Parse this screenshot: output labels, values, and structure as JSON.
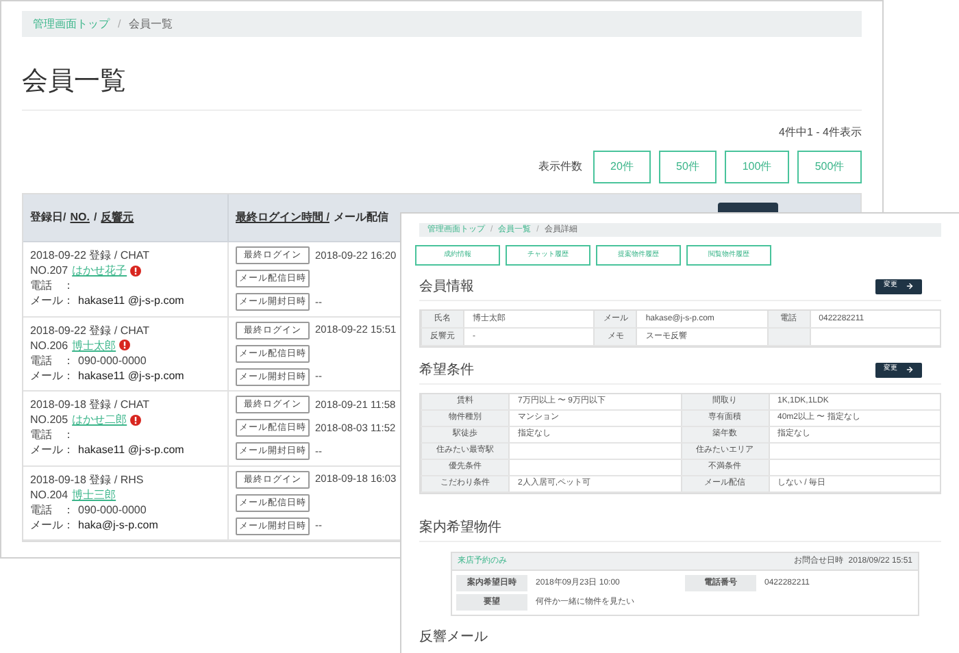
{
  "main": {
    "breadcrumb": [
      {
        "label": "管理画面トップ",
        "link": true
      },
      {
        "label": "会員一覧",
        "link": false
      }
    ],
    "separator": "/",
    "title": "会員一覧",
    "count": "4件中1 - 4件表示",
    "page_size": {
      "label": "表示件数",
      "options": [
        "20件",
        "50件",
        "100件",
        "500件"
      ]
    },
    "table": {
      "header": [
        {
          "segments": [
            {
              "text": "登録日/",
              "link": false
            },
            {
              "text": "NO.",
              "link": true
            },
            {
              "text": "/",
              "link": false
            },
            {
              "text": "反響元",
              "link": true
            }
          ]
        },
        {
          "segments": [
            {
              "text": "最終ログイン時間 /",
              "link": true
            },
            {
              "text": "メール配信",
              "link": false
            }
          ]
        }
      ],
      "rows": [
        {
          "registered": "2018-09-22 登録 / CHAT",
          "no": "NO.207",
          "name": "はかせ花子",
          "alert": true,
          "phone_label": "電話　：",
          "mail_label": "メール：",
          "mail": "hakase11 @j-s-p.com",
          "logs": [
            {
              "label": "最終ログイン",
              "value": "2018-09-22 16:20"
            },
            {
              "label": "メール配信日時"
            },
            {
              "label": "メール開封日時",
              "value": "--"
            }
          ]
        },
        {
          "registered": "2018-09-22 登録 / CHAT",
          "no": "NO.206",
          "name": "博士太郎",
          "alert": true,
          "phone_label": "電話　：",
          "phone": "090-000-0000",
          "mail_label": "メール：",
          "mail": "hakase11 @j-s-p.com",
          "logs": [
            {
              "label": "最終ログイン",
              "value": "2018-09-22 15:51"
            },
            {
              "label": "メール配信日時"
            },
            {
              "label": "メール開封日時",
              "value": "--"
            }
          ]
        },
        {
          "registered": "2018-09-18 登録 / CHAT",
          "no": "NO.205",
          "name": "はかせ二郎",
          "alert": true,
          "phone_label": "電話　：",
          "mail_label": "メール：",
          "mail": "hakase11 @j-s-p.com",
          "logs": [
            {
              "label": "最終ログイン",
              "value": "2018-09-21 11:58"
            },
            {
              "label": "メール配信日時",
              "value": "2018-08-03 11:52"
            },
            {
              "label": "メール開封日時",
              "value": "--"
            }
          ]
        },
        {
          "registered": "2018-09-18 登録 / RHS",
          "no": "NO.204",
          "name": "博士三郎",
          "alert": false,
          "phone_label": "電話　：",
          "phone": "090-000-0000",
          "mail_label": "メール：",
          "mail": "haka@j-s-p.com",
          "logs": [
            {
              "label": "最終ログイン",
              "value": "2018-09-18 16:03"
            },
            {
              "label": "メール配信日時"
            },
            {
              "label": "メール開封日時",
              "value": "--"
            }
          ]
        }
      ]
    }
  },
  "detail": {
    "breadcrumb": [
      {
        "label": "管理画面トップ",
        "link": true
      },
      {
        "label": "会員一覧",
        "link": true
      },
      {
        "label": "会員詳細",
        "link": false
      }
    ],
    "separator": "/",
    "tabs": [
      "成約情報",
      "チャット履歴",
      "提案物件履歴",
      "閲覧物件履歴"
    ],
    "sections": [
      {
        "kind": "fields",
        "title": "会員情報",
        "button": "変更",
        "rows": [
          [
            {
              "label": "氏名",
              "value": "博士太郎"
            },
            {
              "label": "メール",
              "value": "hakase@j-s-p.com"
            },
            {
              "label": "電話",
              "value": "0422282211"
            }
          ],
          [
            {
              "label": "反響元",
              "value": "-"
            },
            {
              "label": "メモ",
              "value": "スーモ反響"
            },
            {}
          ]
        ]
      },
      {
        "kind": "fields",
        "title": "希望条件",
        "button": "変更",
        "rows": [
          [
            {
              "label": "賃料",
              "value": "7万円以上 〜 9万円以下"
            },
            {
              "label": "間取り",
              "value": "1K,1DK,1LDK"
            }
          ],
          [
            {
              "label": "物件種別",
              "value": "マンション"
            },
            {
              "label": "専有面積",
              "value": "40m2以上 〜 指定なし"
            }
          ],
          [
            {
              "label": "駅徒歩",
              "value": "指定なし"
            },
            {
              "label": "築年数",
              "value": "指定なし"
            }
          ],
          [
            {
              "label": "住みたい最寄駅"
            },
            {
              "label": "住みたいエリア"
            }
          ],
          [
            {
              "label": "優先条件"
            },
            {
              "label": "不満条件"
            }
          ],
          [
            {
              "label": "こだわり条件",
              "value": "2人入居可,ペット可"
            },
            {
              "label": "メール配信",
              "value": "しない / 毎日"
            }
          ]
        ]
      },
      {
        "kind": "card",
        "title": "案内希望物件",
        "card": {
          "type": "来店予約のみ",
          "date_label": "お問合せ日時",
          "date": "2018/09/22 15:51",
          "rows": [
            [
              {
                "label": "案内希望日時",
                "value": "2018年09月23日 10:00"
              },
              {
                "label": "電話番号",
                "value": "0422282211"
              }
            ],
            [
              {
                "label": "要望",
                "value": "何件か一緒に物件を見たい"
              }
            ]
          ]
        }
      },
      {
        "kind": "heading",
        "title": "反響メール"
      }
    ]
  }
}
